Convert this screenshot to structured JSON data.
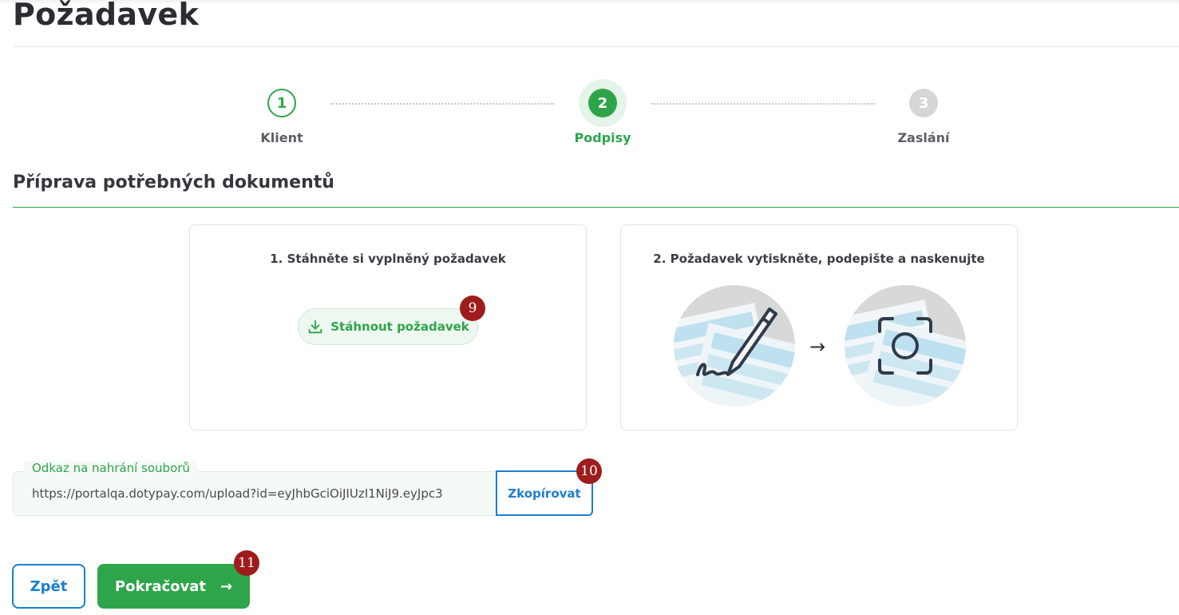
{
  "page": {
    "title": "Požadavek"
  },
  "stepper": {
    "steps": [
      {
        "number": "1",
        "label": "Klient",
        "state": "done"
      },
      {
        "number": "2",
        "label": "Podpisy",
        "state": "active"
      },
      {
        "number": "3",
        "label": "Zaslání",
        "state": "pending"
      }
    ]
  },
  "section": {
    "title": "Příprava potřebných dokumentů"
  },
  "card_download": {
    "heading": "1. Stáhněte si vyplněný požadavek",
    "button_label": "Stáhnout požadavek",
    "badge": "9"
  },
  "card_sign": {
    "heading": "2. Požadavek vytiskněte, podepište a naskenujte",
    "arrow": "→"
  },
  "upload_link": {
    "legend": "Odkaz na nahrání souborů",
    "value": "https://portalqa.dotypay.com/upload?id=eyJhbGciOiJIUzI1NiJ9.eyJpc3",
    "copy_label": "Zkopírovat",
    "badge": "10"
  },
  "footer": {
    "back_label": "Zpět",
    "continue_label": "Pokračovat",
    "continue_arrow": "→",
    "badge": "11"
  },
  "colors": {
    "brand_green": "#2ea54a",
    "link_blue": "#1c7fcf",
    "badge_red": "#9e1c1c"
  }
}
